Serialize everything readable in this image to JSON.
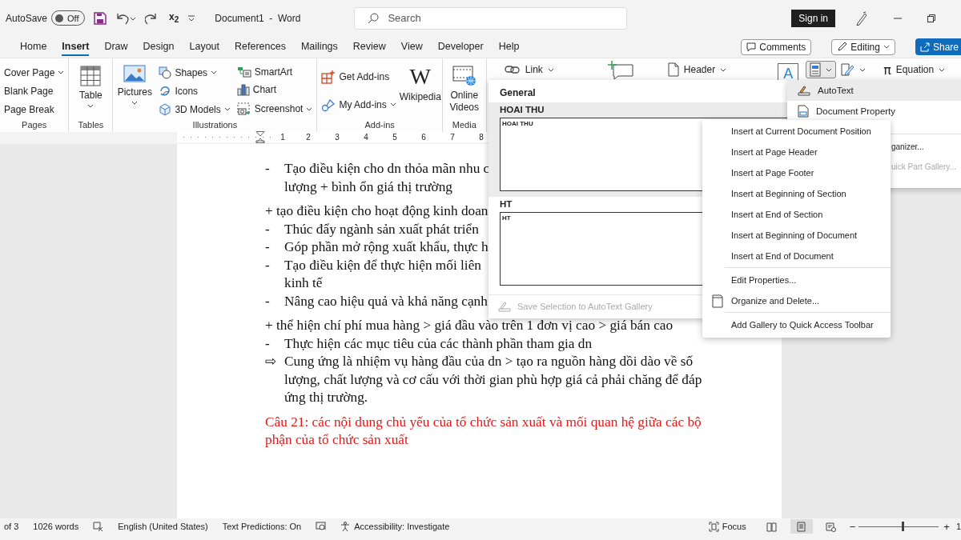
{
  "titlebar": {
    "autosave": {
      "label": "AutoSave",
      "on": false,
      "state_text": "Off"
    },
    "subscript": "x$_{2}$",
    "document_title": "Document1  -  Word",
    "search": {
      "placeholder": "Search"
    },
    "sign_in": "Sign in"
  },
  "tabs": [
    {
      "label": "Home",
      "selected": false
    },
    {
      "label": "Insert",
      "selected": true
    },
    {
      "label": "Draw",
      "selected": false
    },
    {
      "label": "Design",
      "selected": false
    },
    {
      "label": "Layout",
      "selected": false
    },
    {
      "label": "References",
      "selected": false
    },
    {
      "label": "Mailings",
      "selected": false
    },
    {
      "label": "Review",
      "selected": false
    },
    {
      "label": "View",
      "selected": false
    },
    {
      "label": "Developer",
      "selected": false
    },
    {
      "label": "Help",
      "selected": false
    }
  ],
  "header_buttons": {
    "comments": "Comments",
    "editing": "Editing",
    "share": "Share"
  },
  "ribbon": {
    "groups": [
      {
        "label": "Pages",
        "items": [
          {
            "label": "Cover Page",
            "kind": "text",
            "dropdown": true
          },
          {
            "label": "Blank Page",
            "kind": "text",
            "dropdown": false
          },
          {
            "label": "Page Break",
            "kind": "text",
            "dropdown": false
          }
        ]
      },
      {
        "label": "Tables",
        "items": [
          {
            "label": "Table",
            "kind": "large",
            "dropdown": true
          }
        ]
      },
      {
        "label": "Illustrations",
        "items": [
          {
            "label": "Pictures",
            "kind": "large",
            "dropdown": true
          },
          {
            "label": "Shapes",
            "kind": "small",
            "dropdown": true
          },
          {
            "label": "Icons",
            "kind": "small",
            "dropdown": false
          },
          {
            "label": "3D Models",
            "kind": "small",
            "dropdown": true
          },
          {
            "label": "SmartArt",
            "kind": "small",
            "dropdown": false
          },
          {
            "label": "Chart",
            "kind": "small",
            "dropdown": false
          },
          {
            "label": "Screenshot",
            "kind": "small",
            "dropdown": true
          }
        ]
      },
      {
        "label": "Add-ins",
        "items": [
          {
            "label": "Get Add-ins",
            "kind": "small",
            "dropdown": false
          },
          {
            "label": "My Add-ins",
            "kind": "small",
            "dropdown": true
          },
          {
            "label": "Wikipedia",
            "kind": "large",
            "glyph": "W",
            "dropdown": false
          }
        ]
      },
      {
        "label": "Media",
        "items": [
          {
            "label": "Online Videos",
            "kind": "large",
            "dropdown": false
          }
        ]
      }
    ],
    "top_row": [
      {
        "label": "Link",
        "dropdown": true,
        "pressed": false
      },
      {
        "dropdown": false,
        "pressed": false
      },
      {
        "label": "Header",
        "dropdown": true,
        "pressed": false
      },
      {
        "glyph": "A",
        "dropdown": false,
        "pressed": false
      },
      {
        "dropdown": true,
        "pressed": true
      },
      {
        "dropdown": true,
        "pressed": false
      },
      {
        "label": "Equation",
        "glyph": "π",
        "dropdown": true,
        "pressed": false
      }
    ]
  },
  "ruler": {
    "numbers": [
      "1",
      "2",
      "3",
      "4",
      "5",
      "6",
      "7",
      "8"
    ]
  },
  "document": {
    "blocks": [
      {
        "kind": "list",
        "items": [
          {
            "marker": "-",
            "lines": [
              "Tạo điều kiện cho dn thỏa mãn nhu c",
              "lượng + bình ổn giá thị trường"
            ]
          }
        ]
      },
      {
        "kind": "para",
        "text": "+ tạo điều kiện cho hoạt động kinh doan"
      },
      {
        "kind": "list",
        "items": [
          {
            "marker": "-",
            "lines": [
              "Thúc đẩy ngành sản xuất phát triển"
            ]
          },
          {
            "marker": "-",
            "lines": [
              "Góp phần mở rộng xuất khẩu, thực h"
            ]
          },
          {
            "marker": "-",
            "lines": [
              "Tạo điều kiện để thực hiện mối liên",
              "kinh tế"
            ]
          },
          {
            "marker": "-",
            "lines": [
              "Nâng cao hiệu quả và khả năng cạnh"
            ]
          }
        ]
      },
      {
        "kind": "para",
        "text": "+ thể hiện chí phí mua hàng > giá đầu vào trên 1 đơn vị cao > giá bán cao"
      },
      {
        "kind": "list",
        "items": [
          {
            "marker": "-",
            "lines": [
              "Thực hiện các mục tiêu của các thành phần tham gia dn"
            ]
          },
          {
            "marker": "⇨",
            "lines": [
              "Cung ứng là nhiệm vụ hàng đầu của dn > tạo ra nguồn hàng dồi dào về số lượng, chất lượng và cơ cấu với thời gian phù hợp giá cả phải chăng để đáp ứng thị trường."
            ]
          }
        ]
      },
      {
        "kind": "heading",
        "text": "Câu 21: các nội dung chủ yếu của tổ chức sản xuất và mối quan hệ giữa các bộ phận của tổ chức sản xuất"
      }
    ]
  },
  "autotext_gallery": {
    "heading": "General",
    "entries": [
      {
        "name": "HOAI THU",
        "preview": "HOAI THU",
        "selected": true
      },
      {
        "name": "HT",
        "preview": "HT",
        "selected": false
      }
    ],
    "footer": {
      "label": "Save Selection to AutoText Gallery",
      "disabled": true
    }
  },
  "quick_parts_menu": [
    {
      "label": "AutoText",
      "kind": "icon",
      "selected": true,
      "disabled": false
    },
    {
      "label": "Document Property",
      "kind": "icon",
      "selected": false,
      "disabled": false
    },
    {
      "label": "ganizer...",
      "kind": "cut",
      "selected": false,
      "disabled": false
    },
    {
      "label": "uick Part Gallery...",
      "kind": "cut",
      "selected": false,
      "disabled": true
    }
  ],
  "context_menu": {
    "groups": [
      [
        {
          "label": "Insert at Current Document Position",
          "kind": "text"
        },
        {
          "label": "Insert at Page Header",
          "kind": "text"
        },
        {
          "label": "Insert at Page Footer",
          "kind": "text"
        },
        {
          "label": "Insert at Beginning of Section",
          "kind": "text"
        },
        {
          "label": "Insert at End of Section",
          "kind": "text"
        },
        {
          "label": "Insert at Beginning of Document",
          "kind": "text"
        },
        {
          "label": "Insert at End of Document",
          "kind": "text"
        }
      ],
      [
        {
          "label": "Edit Properties...",
          "kind": "text"
        },
        {
          "label": "Organize and Delete...",
          "kind": "icon"
        }
      ],
      [
        {
          "label": "Add Gallery to Quick Access Toolbar",
          "kind": "text"
        }
      ]
    ]
  },
  "status_bar": {
    "page": "of 3",
    "words": "1026 words",
    "language": "English (United States)",
    "predictions": "Text Predictions: On",
    "accessibility": "Accessibility: Investigate",
    "focus": "Focus",
    "views": [
      {
        "selected": false
      },
      {
        "selected": true
      },
      {
        "selected": false
      }
    ],
    "zoom": {
      "minus": "−",
      "plus": "+",
      "level": 0.55,
      "percent": "1"
    }
  }
}
